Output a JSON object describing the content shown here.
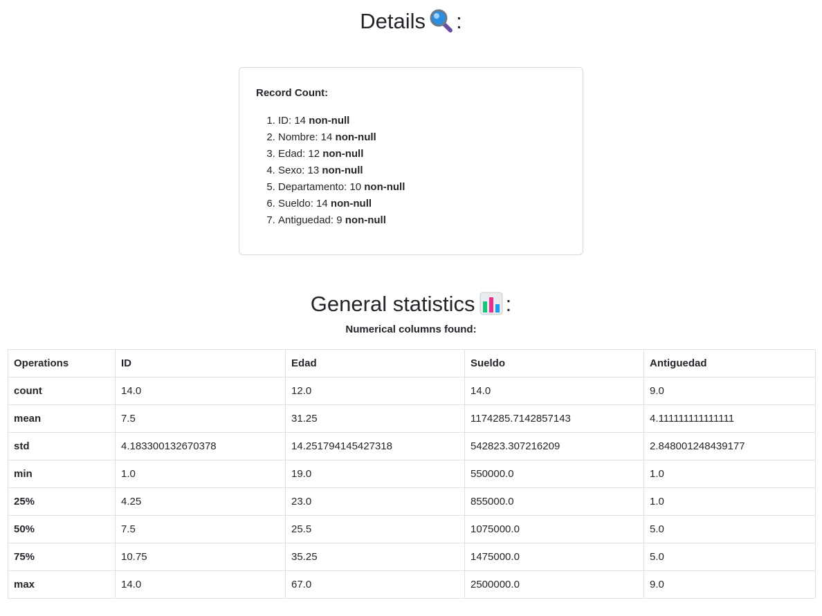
{
  "details": {
    "title": "Details",
    "colon": ":",
    "record_count_label": "Record Count:",
    "items": [
      {
        "text": "ID: 14",
        "suffix": "non-null"
      },
      {
        "text": "Nombre: 14",
        "suffix": "non-null"
      },
      {
        "text": "Edad: 12",
        "suffix": "non-null"
      },
      {
        "text": "Sexo: 13",
        "suffix": "non-null"
      },
      {
        "text": "Departamento: 10",
        "suffix": "non-null"
      },
      {
        "text": "Sueldo: 14",
        "suffix": "non-null"
      },
      {
        "text": "Antiguedad: 9",
        "suffix": "non-null"
      }
    ],
    "icon": "magnifying-glass-icon"
  },
  "statistics": {
    "title": "General statistics",
    "colon": ":",
    "subtitle": "Numerical columns found:",
    "icon": "bar-chart-icon",
    "columns": [
      "Operations",
      "ID",
      "Edad",
      "Sueldo",
      "Antiguedad"
    ],
    "rows": [
      [
        "count",
        "14.0",
        "12.0",
        "14.0",
        "9.0"
      ],
      [
        "mean",
        "7.5",
        "31.25",
        "1174285.7142857143",
        "4.111111111111111"
      ],
      [
        "std",
        "4.183300132670378",
        "14.251794145427318",
        "542823.307216209",
        "2.848001248439177"
      ],
      [
        "min",
        "1.0",
        "19.0",
        "550000.0",
        "1.0"
      ],
      [
        "25%",
        "4.25",
        "23.0",
        "855000.0",
        "1.0"
      ],
      [
        "50%",
        "7.5",
        "25.5",
        "1075000.0",
        "5.0"
      ],
      [
        "75%",
        "10.75",
        "35.25",
        "1475000.0",
        "5.0"
      ],
      [
        "max",
        "14.0",
        "67.0",
        "2500000.0",
        "9.0"
      ]
    ]
  }
}
